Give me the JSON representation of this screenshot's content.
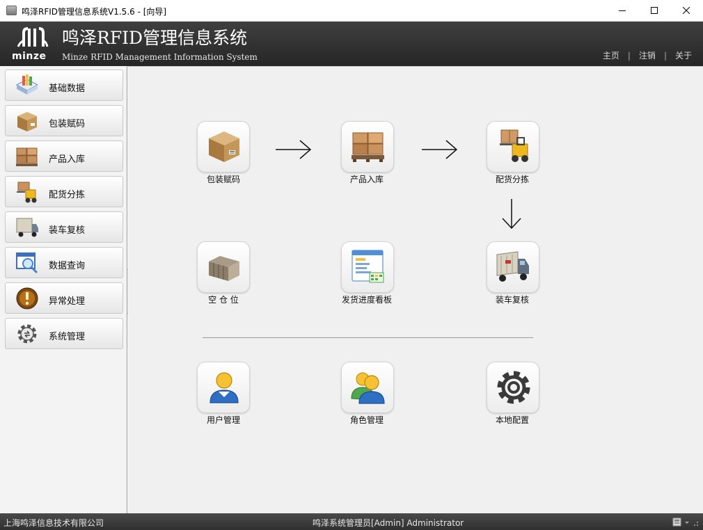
{
  "window": {
    "title": "鸣泽RFID管理信息系统V1.5.6 - [向导]"
  },
  "header": {
    "logo_text": "minze",
    "system_title": "鸣泽RFID管理信息系统",
    "system_subtitle": "Minze RFID Management Information System",
    "nav": [
      {
        "label": "主页"
      },
      {
        "label": "注销"
      },
      {
        "label": "关于"
      }
    ],
    "nav_separator": "|"
  },
  "sidebar": {
    "items": [
      {
        "label": "基础数据",
        "icon": "basic-data-icon"
      },
      {
        "label": "包装赋码",
        "icon": "package-box-icon"
      },
      {
        "label": "产品入库",
        "icon": "pallet-boxes-icon"
      },
      {
        "label": "配货分拣",
        "icon": "forklift-icon"
      },
      {
        "label": "装车复核",
        "icon": "truck-icon"
      },
      {
        "label": "数据查询",
        "icon": "magnifier-icon"
      },
      {
        "label": "异常处理",
        "icon": "exclamation-icon"
      },
      {
        "label": "系统管理",
        "icon": "gear-icon"
      }
    ]
  },
  "main": {
    "tiles": [
      {
        "label": "包装赋码",
        "icon": "package-box-icon"
      },
      {
        "label": "产品入库",
        "icon": "pallet-boxes-icon"
      },
      {
        "label": "配货分拣",
        "icon": "forklift-icon"
      },
      {
        "label": "空 仓 位",
        "icon": "empty-rack-icon"
      },
      {
        "label": "发货进度看板",
        "icon": "progress-board-icon"
      },
      {
        "label": "装车复核",
        "icon": "truck-icon"
      },
      {
        "label": "用户管理",
        "icon": "user-icon"
      },
      {
        "label": "角色管理",
        "icon": "role-users-icon"
      },
      {
        "label": "本地配置",
        "icon": "gear-icon"
      }
    ]
  },
  "statusbar": {
    "company": "上海鸣泽信息技术有限公司",
    "user": "鸣泽系统管理员[Admin]  Administrator"
  },
  "colors": {
    "header_bg": "#2f2f2f",
    "statusbar_bg": "#3a3a3a",
    "main_bg": "#f0f0f0"
  }
}
